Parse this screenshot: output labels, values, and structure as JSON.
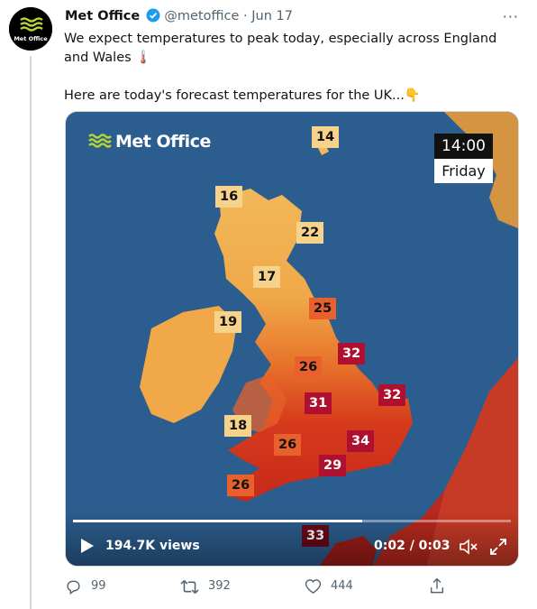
{
  "tweet": {
    "author_name": "Met Office",
    "handle": "@metoffice",
    "separator": "·",
    "date": "Jun 17",
    "more_label": "···",
    "text_line1": "We expect temperatures to peak today, especially across England and Wales 🌡️",
    "text_line2": "Here are today's forecast temperatures for the UK...👇",
    "avatar_text": "Met Office"
  },
  "media": {
    "logo_text": "Met Office",
    "time": "14:00",
    "day": "Friday",
    "temperatures": [
      {
        "id": "n-sea",
        "value": "14",
        "style": "light"
      },
      {
        "id": "w-highlands",
        "value": "16",
        "style": "light"
      },
      {
        "id": "aberdeen",
        "value": "22",
        "style": "light"
      },
      {
        "id": "scot-borders",
        "value": "17",
        "style": "light"
      },
      {
        "id": "belfast",
        "value": "19",
        "style": "light"
      },
      {
        "id": "yorkshire",
        "value": "25",
        "style": "orange"
      },
      {
        "id": "lincs",
        "value": "32",
        "style": "red"
      },
      {
        "id": "cheshire",
        "value": "26",
        "style": "orange"
      },
      {
        "id": "norfolk",
        "value": "32",
        "style": "red"
      },
      {
        "id": "midlands",
        "value": "31",
        "style": "red"
      },
      {
        "id": "pembroke",
        "value": "18",
        "style": "light"
      },
      {
        "id": "cardiff",
        "value": "26",
        "style": "orange"
      },
      {
        "id": "london",
        "value": "34",
        "style": "red"
      },
      {
        "id": "hampshire",
        "value": "29",
        "style": "red"
      },
      {
        "id": "devon",
        "value": "26",
        "style": "orange"
      },
      {
        "id": "channel",
        "value": "33",
        "style": "dark"
      }
    ],
    "views": "194.7K views",
    "time_readout": "0:02 / 0:03",
    "progress": 0.66
  },
  "actions": {
    "replies": "99",
    "retweets": "392",
    "likes": "444"
  },
  "colors": {
    "sea": "#2c5d8f",
    "land_cool": "#f2b85a",
    "land_warm": "#e8762c",
    "land_hot": "#c62a1a",
    "text_secondary": "#536471",
    "verified": "#1d9bf0"
  }
}
